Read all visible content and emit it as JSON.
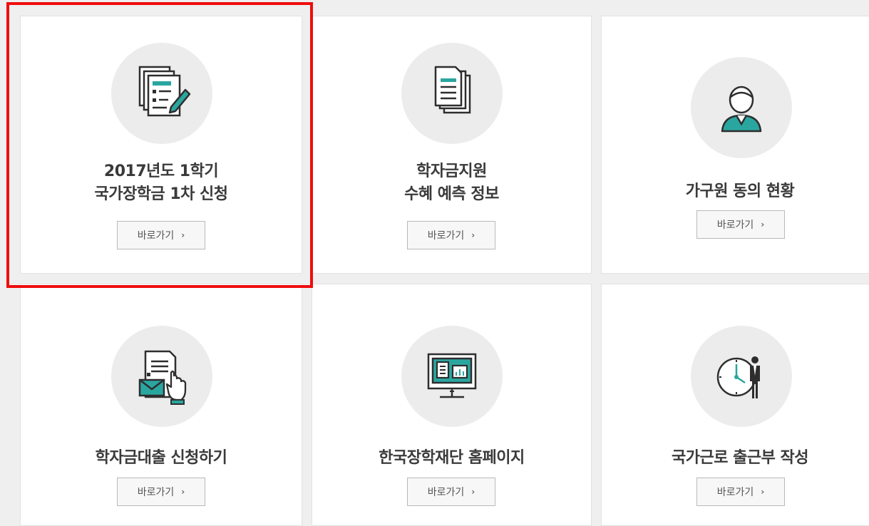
{
  "colors": {
    "accent_teal": "#2aa6a0",
    "highlight_red": "#ef0d0d",
    "icon_dark": "#2e2e2e"
  },
  "cards": [
    {
      "title_line1": "2017년도 1학기",
      "title_line2": "국가장학금 1차 신청",
      "button_label": "바로가기",
      "chevron": "›",
      "icon": "application-form-icon"
    },
    {
      "title_line1": "학자금지원",
      "title_line2": "수혜 예측 정보",
      "button_label": "바로가기",
      "chevron": "›",
      "icon": "documents-icon"
    },
    {
      "title_line1": "가구원 동의 현황",
      "title_line2": "",
      "button_label": "바로가기",
      "chevron": "›",
      "icon": "family-member-icon"
    },
    {
      "title_line1": "학자금대출 신청하기",
      "title_line2": "",
      "button_label": "바로가기",
      "chevron": "›",
      "icon": "loan-application-icon"
    },
    {
      "title_line1": "한국장학재단 홈페이지",
      "title_line2": "",
      "button_label": "바로가기",
      "chevron": "›",
      "icon": "monitor-icon"
    },
    {
      "title_line1": "국가근로 출근부 작성",
      "title_line2": "",
      "button_label": "바로가기",
      "chevron": "›",
      "icon": "clock-worker-icon"
    }
  ]
}
